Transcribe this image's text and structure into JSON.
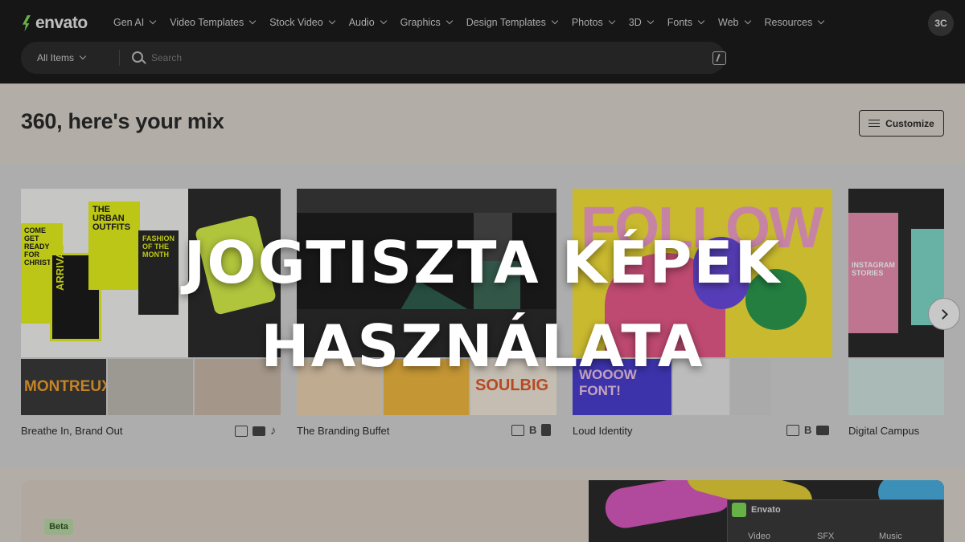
{
  "brand": {
    "name": "envato",
    "accent": "#7ed957"
  },
  "nav": {
    "items": [
      "Gen AI",
      "Video Templates",
      "Stock Video",
      "Audio",
      "Graphics",
      "Design Templates",
      "Photos",
      "3D",
      "Fonts",
      "Web",
      "Resources"
    ],
    "avatar": "3C"
  },
  "search": {
    "scope": "All Items",
    "placeholder": "Search"
  },
  "greeting": "360, here's your mix",
  "customize_label": "Customize",
  "collections": [
    {
      "title": "Breathe In, Brand Out",
      "badges": [
        "",
        "",
        ""
      ]
    },
    {
      "title": "The Branding Buffet",
      "badges": [
        "",
        "B",
        ""
      ]
    },
    {
      "title": "Loud Identity",
      "badges": [
        "",
        "B",
        ""
      ]
    },
    {
      "title": "Digital Campus",
      "badges": []
    }
  ],
  "tiles": {
    "c1": {
      "urban": "THE URBAN OUTFITS",
      "christmas": "COME GET READY FOR CHRISTMAS",
      "arrival": "ARRIVAL",
      "fashion": "FASHION OF THE MONTH",
      "montreux": "MONTREUX"
    },
    "c2": {
      "soulbig": "SOULBIG"
    },
    "c3": {
      "follow": "FOLLOW",
      "font": "WOOOW FONT!"
    },
    "c4": {
      "stories": "INSTAGRAM STORIES"
    }
  },
  "promo": {
    "badge": "Beta",
    "plugin_title": "Envato",
    "plugin_tabs": [
      "Video",
      "SFX",
      "Music"
    ]
  },
  "overlay": {
    "line1": "JOGTISZTA KÉPEK",
    "line2": "HASZNÁLATA"
  }
}
